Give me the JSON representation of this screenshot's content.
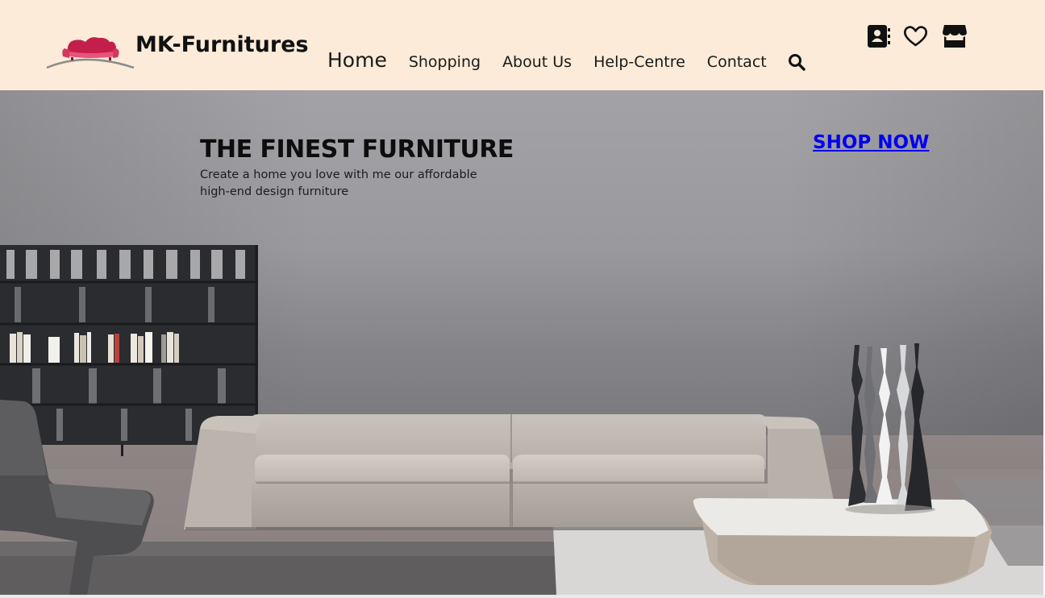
{
  "header": {
    "brand": "MK-Furnitures",
    "logo_icon": "sofa-logo-icon",
    "background": "#fbebd8"
  },
  "nav": {
    "items": [
      {
        "label": "Home",
        "active": true
      },
      {
        "label": "Shopping"
      },
      {
        "label": "About Us"
      },
      {
        "label": "Help-Centre"
      },
      {
        "label": "Contact"
      }
    ],
    "search_icon": "search-icon"
  },
  "top_icons": [
    "address-book-icon",
    "heart-icon",
    "store-icon"
  ],
  "hero": {
    "title": "THE FINEST FURNITURE",
    "subtitle": "Create a home you love with me our affordable high-end design furniture",
    "cta": "SHOP NOW",
    "cta_color": "#0000ee"
  }
}
